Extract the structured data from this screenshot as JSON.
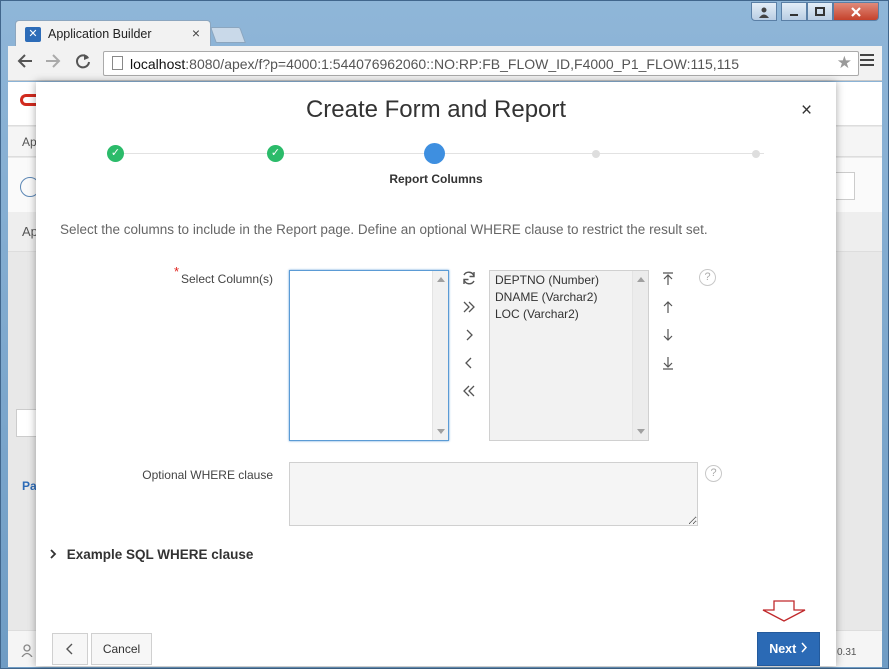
{
  "browser": {
    "tab_title": "Application Builder",
    "tab_close": "×",
    "url_host": "localhost",
    "url_rest": ":8080/apex/f?p=4000:1:544076962060::NO:RP:FB_FLOW_ID,F4000_P1_FLOW:115,115"
  },
  "background_page": {
    "crumb_1": "Ap",
    "crumb_2": "Ap",
    "left_link": "Pa",
    "version": "0.31"
  },
  "modal": {
    "title": "Create Form and Report",
    "close_label": "×",
    "wizard": {
      "steps": [
        {
          "state": "complete"
        },
        {
          "state": "complete"
        },
        {
          "state": "current",
          "label": "Report Columns"
        },
        {
          "state": "future"
        },
        {
          "state": "future"
        }
      ],
      "current_label": "Report Columns"
    },
    "instructions": "Select the columns to include in the Report page. Define an optional WHERE clause to restrict the result set.",
    "select_columns": {
      "label": "Select Column(s)",
      "required_marker": "*",
      "available": [],
      "selected": [
        "DEPTNO (Number)",
        "DNAME (Varchar2)",
        "LOC (Varchar2)"
      ]
    },
    "where_clause": {
      "label": "Optional WHERE clause",
      "value": ""
    },
    "example_section": "Example SQL WHERE clause",
    "footer": {
      "previous_icon": "chevron-left",
      "cancel_label": "Cancel",
      "next_label": "Next"
    }
  },
  "colors": {
    "accent": "#2b6ab5",
    "step_done": "#2bbb6a",
    "step_current": "#3e8fe0",
    "required": "#e0201b",
    "annotation": "#c0282b"
  }
}
